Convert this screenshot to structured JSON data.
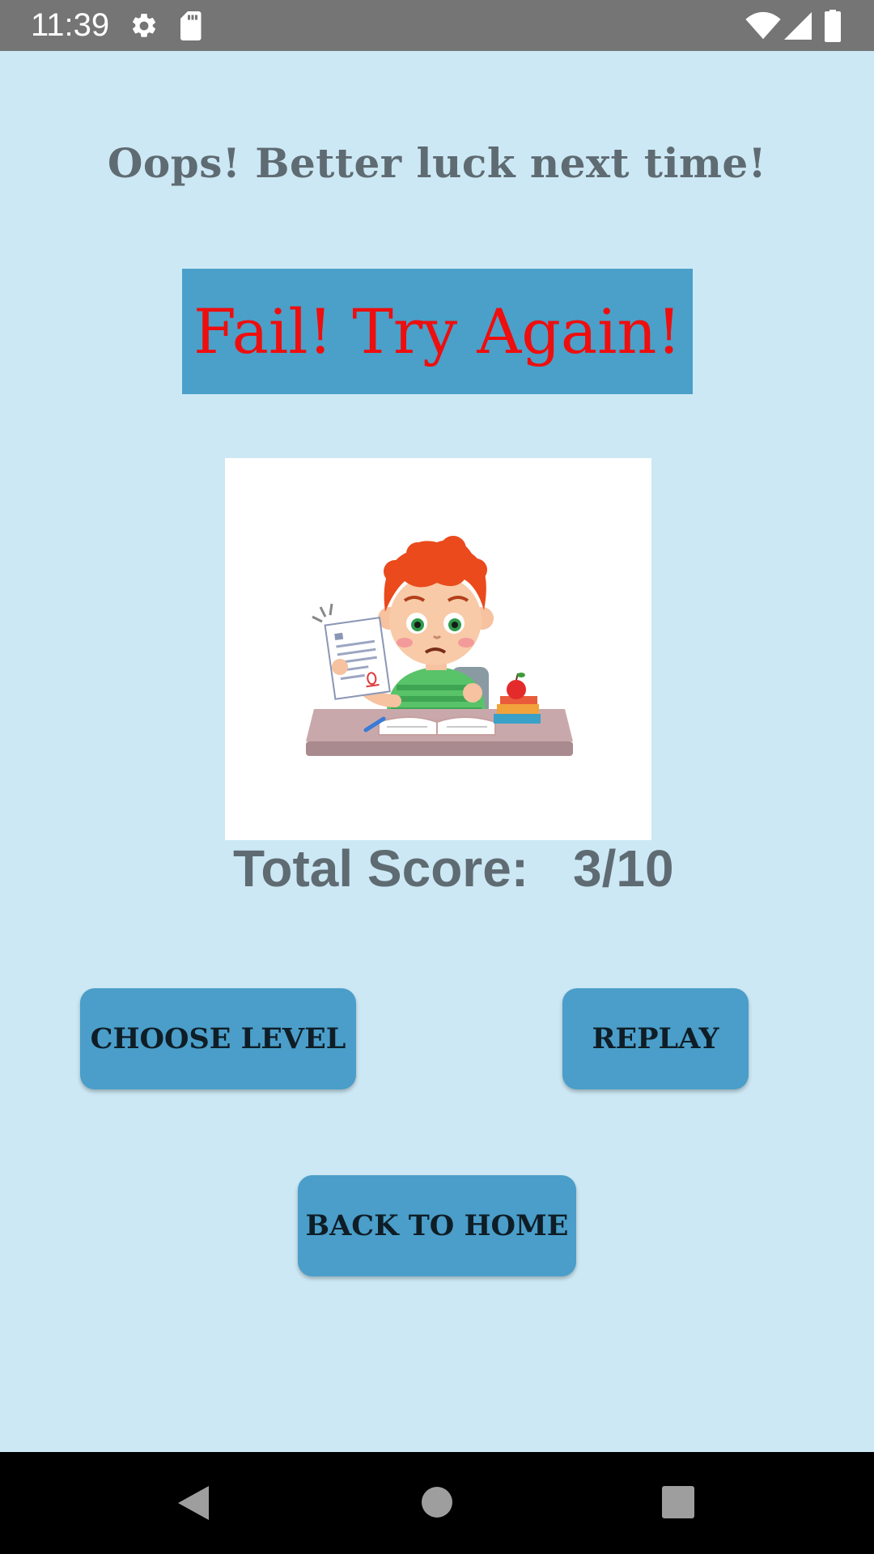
{
  "status_bar": {
    "time": "11:39",
    "icons_left": [
      "gear-icon",
      "sd-card-icon"
    ],
    "icons_right": [
      "wifi-icon",
      "signal-icon",
      "battery-icon"
    ]
  },
  "heading": "Oops! Better luck next time!",
  "result_banner": {
    "text": "Fail! Try Again!",
    "text_color": "#ee0e0e",
    "background": "#4aa0c9"
  },
  "illustration": {
    "icon": "sad-student-failed-test-illustration"
  },
  "score": {
    "label": "Total Score:",
    "value": "3/10"
  },
  "buttons": {
    "choose_level": "CHOOSE LEVEL",
    "replay": "REPLAY",
    "back_to_home": "BACK TO HOME"
  },
  "nav_bar": {
    "icons": [
      "back-icon",
      "home-icon",
      "recents-icon"
    ]
  },
  "colors": {
    "background": "#cce8f4",
    "button": "#4a9ec9",
    "heading_text": "#5f6b72"
  }
}
